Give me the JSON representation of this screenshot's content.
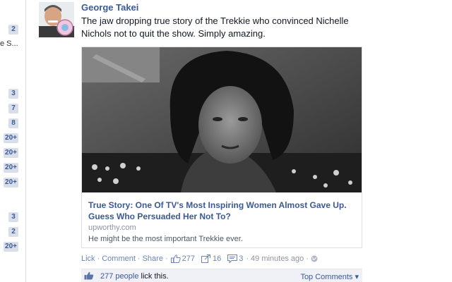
{
  "sidebar": {
    "counts": [
      "2",
      "3",
      "7",
      "8",
      "20+",
      "20+",
      "20+",
      "20+",
      "3",
      "2",
      "20+"
    ],
    "truncated_text": "e S..."
  },
  "post": {
    "author": "George Takei",
    "text": "The jaw dropping true story of the Trekkie who convinced Nichelle Nichols not to quit the show. Simply amazing."
  },
  "link_card": {
    "title": "True Story: One Of TV's Most Inspiring Women Almost Gave Up. Guess Who Persuaded Her Not To?",
    "domain": "upworthy.com",
    "description": "He might be the most important Trekkie ever."
  },
  "actions": {
    "lick": "Lick",
    "comment": "Comment",
    "share": "Share",
    "like_count": "277",
    "share_count": "16",
    "comment_count": "3",
    "time": "49 minutes ago"
  },
  "like_bar": {
    "people": "277 people",
    "suffix": "lick this.",
    "top_comments": "Top Comments ▾"
  },
  "colors": {
    "link": "#3b5998",
    "badge_bg": "#d8dfea",
    "like_bar_bg": "#eff1f7"
  }
}
